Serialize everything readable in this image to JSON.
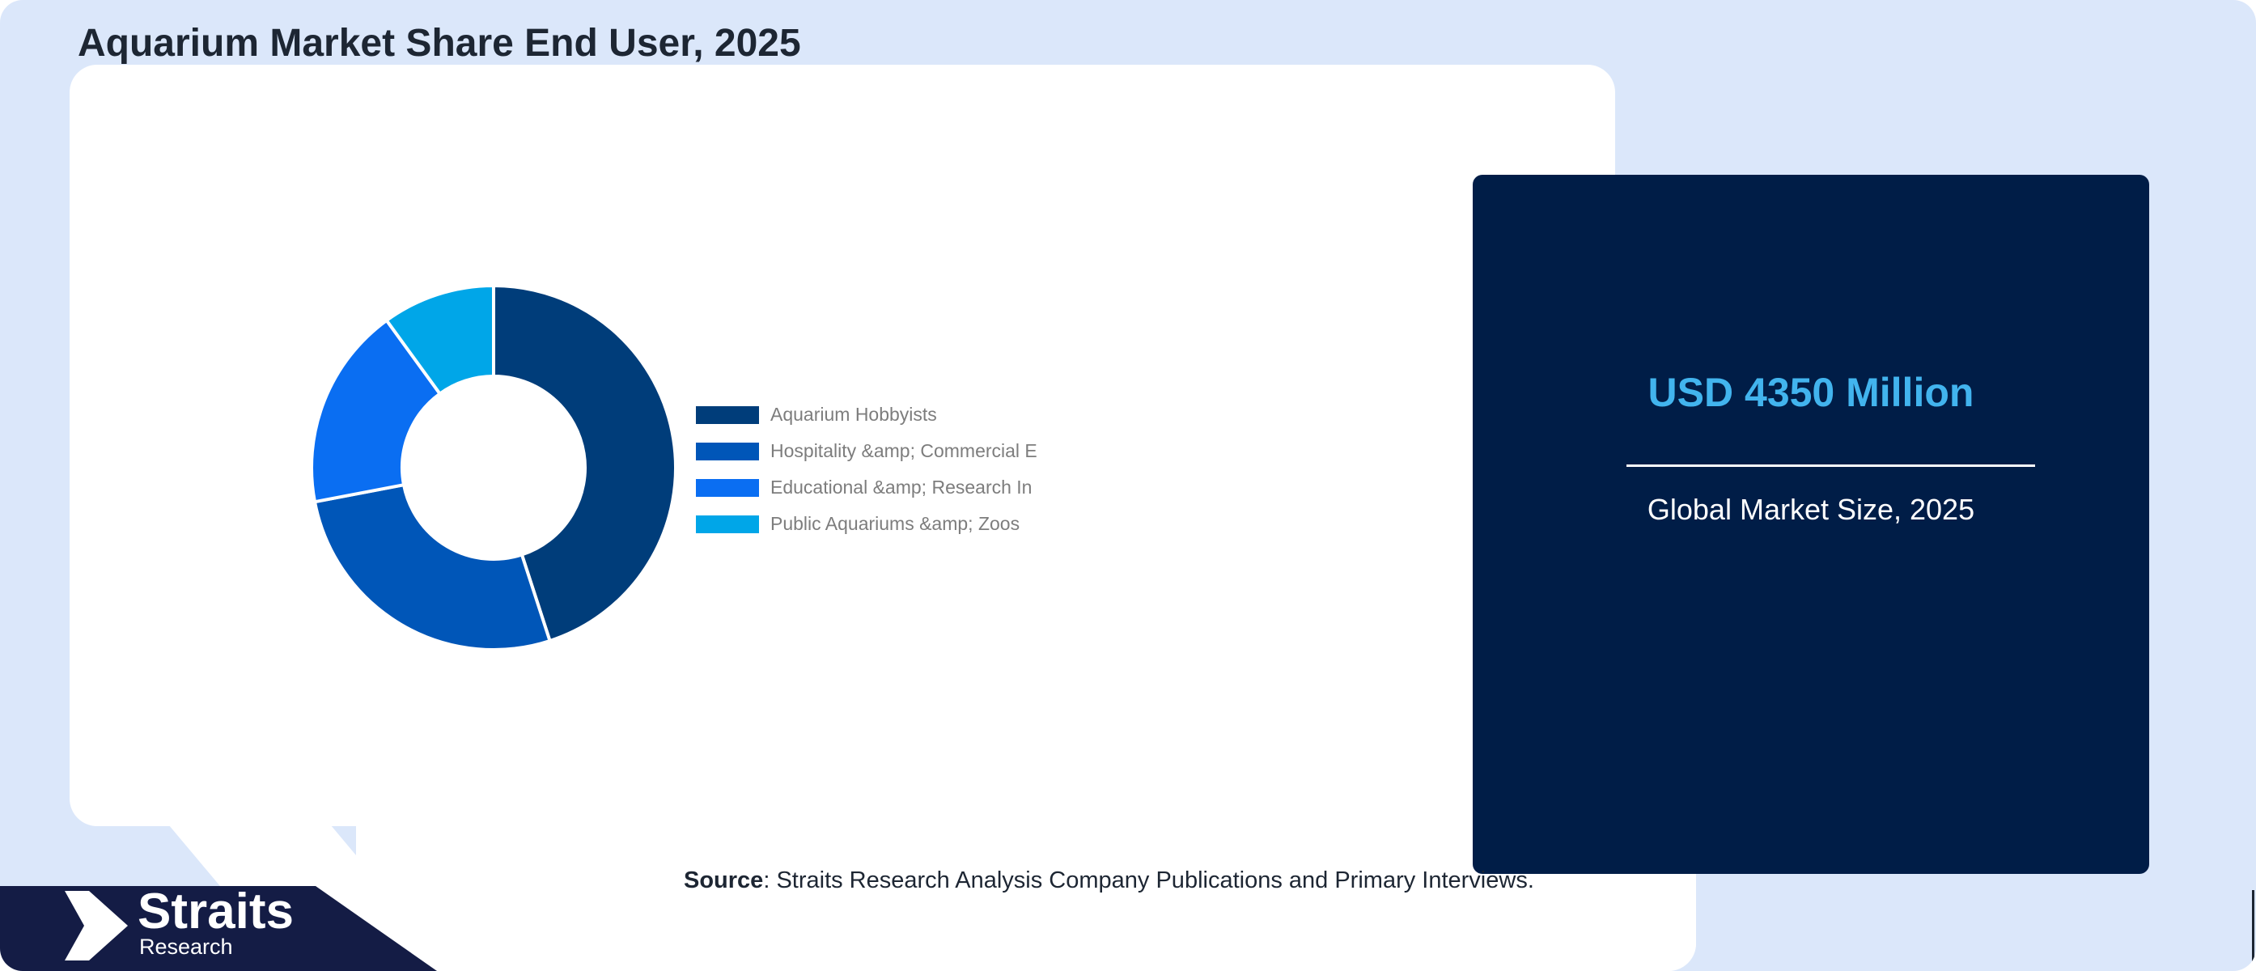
{
  "header": {
    "title": "Aquarium Market Share End User, 2025"
  },
  "chart_data": {
    "type": "pie",
    "donut": true,
    "categories": [
      "Aquarium Hobbyists",
      "Hospitality &amp; Commercial E",
      "Educational &amp; Research In",
      "Public Aquariums &amp; Zoos"
    ],
    "values": [
      45,
      27,
      18,
      10
    ],
    "colors": [
      "#003d7a",
      "#0056b8",
      "#0a6ef2",
      "#00a6e8"
    ],
    "legend": "right"
  },
  "stat": {
    "value": "USD 4350 Million",
    "label": "Global Market Size, 2025"
  },
  "footer": {
    "source_label": "Source",
    "source_text": ": Straits Research Analysis Company Publications and Primary Interviews."
  },
  "logo": {
    "name": "Straits",
    "sub": "Research"
  },
  "colors": {
    "background": "#dbe7fa",
    "panel": "#001d47",
    "accent": "#42b4ee"
  }
}
